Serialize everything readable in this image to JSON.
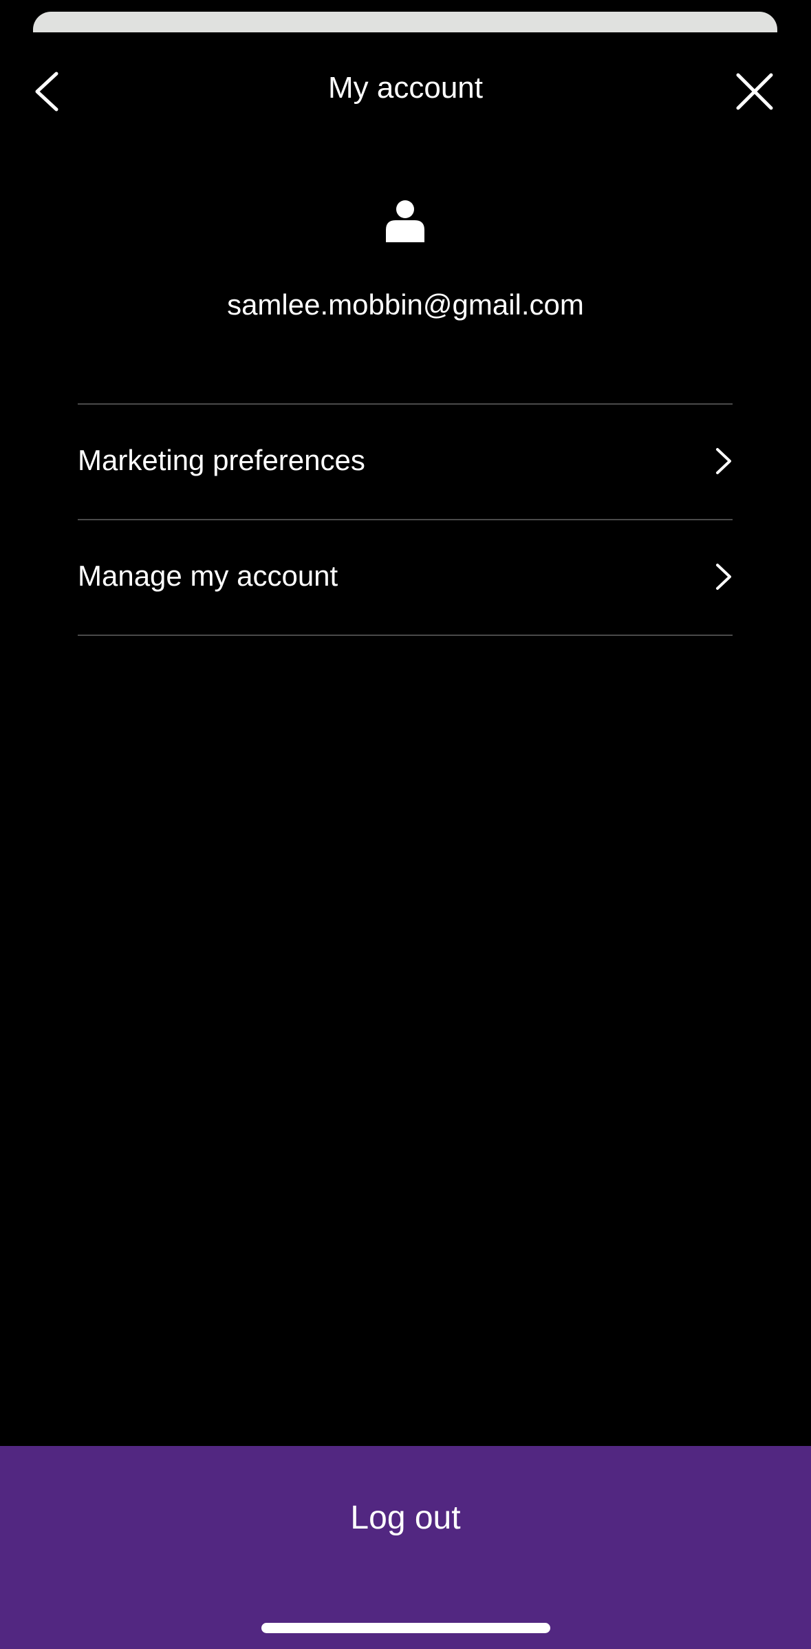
{
  "header": {
    "title": "My account",
    "back_icon": "chevron-left-icon",
    "close_icon": "close-icon"
  },
  "profile": {
    "icon": "user-icon",
    "email": "samlee.mobbin@gmail.com"
  },
  "menu": {
    "items": [
      {
        "label": "Marketing preferences",
        "icon": "chevron-right-icon"
      },
      {
        "label": "Manage my account",
        "icon": "chevron-right-icon"
      }
    ]
  },
  "footer": {
    "logout_label": "Log out"
  },
  "colors": {
    "background": "#000000",
    "accent": "#522781",
    "divider": "#4a4a4a",
    "text": "#ffffff",
    "sheet_edge": "#e0e1df"
  }
}
